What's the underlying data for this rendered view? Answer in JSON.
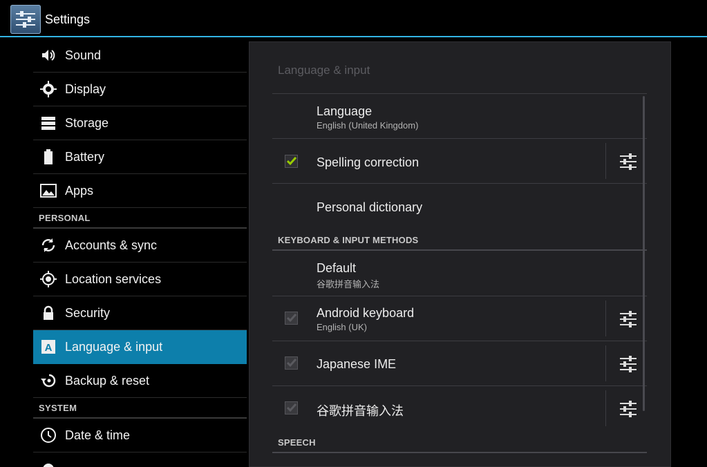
{
  "app": {
    "title": "Settings"
  },
  "sidebar": {
    "items_top": [
      {
        "label": "Sound",
        "icon": "speaker-icon"
      },
      {
        "label": "Display",
        "icon": "brightness-icon"
      },
      {
        "label": "Storage",
        "icon": "storage-icon"
      },
      {
        "label": "Battery",
        "icon": "battery-icon"
      },
      {
        "label": "Apps",
        "icon": "apps-icon"
      }
    ],
    "personal_header": "PERSONAL",
    "items_personal": [
      {
        "label": "Accounts & sync",
        "icon": "sync-icon"
      },
      {
        "label": "Location services",
        "icon": "location-icon"
      },
      {
        "label": "Security",
        "icon": "lock-icon"
      },
      {
        "label": "Language & input",
        "icon": "language-icon",
        "selected": true
      },
      {
        "label": "Backup & reset",
        "icon": "backup-icon"
      }
    ],
    "system_header": "SYSTEM",
    "items_system": [
      {
        "label": "Date & time",
        "icon": "clock-icon"
      }
    ]
  },
  "panel": {
    "title": "Language & input",
    "language": {
      "title": "Language",
      "summary": "English (United Kingdom)"
    },
    "spelling": {
      "title": "Spelling correction",
      "checked": true
    },
    "dictionary": {
      "title": "Personal dictionary"
    },
    "keyboard_section": "KEYBOARD & INPUT METHODS",
    "default": {
      "title": "Default",
      "summary": "谷歌拼音输入法"
    },
    "android_keyboard": {
      "title": "Android keyboard",
      "summary": "English (UK)",
      "checked": true
    },
    "japanese_ime": {
      "title": "Japanese IME",
      "checked": true
    },
    "google_pinyin": {
      "title": "谷歌拼音输入法",
      "checked": true
    },
    "speech_section": "SPEECH"
  },
  "colors": {
    "accent": "#33b5e5",
    "selected": "#0d7fab",
    "check": "#99cc00"
  }
}
